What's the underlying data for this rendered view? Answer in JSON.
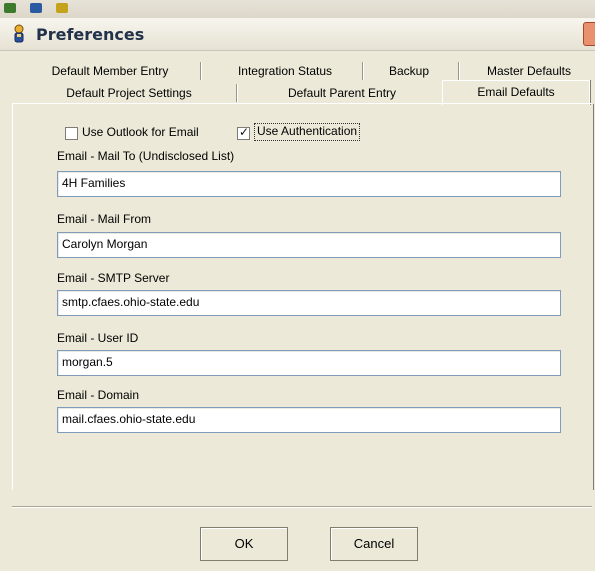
{
  "window": {
    "title": "Preferences"
  },
  "tabs": {
    "row1": [
      "Default Member Entry",
      "Integration Status",
      "Backup",
      "Master Defaults"
    ],
    "row2": [
      "Default Project Settings",
      "Default Parent Entry",
      "Email Defaults"
    ],
    "active": "Email Defaults"
  },
  "options": {
    "use_outlook_label": "Use Outlook for Email",
    "use_outlook_checked": false,
    "use_auth_label": "Use Authentication",
    "use_auth_checked": true,
    "check_mark": "✓"
  },
  "fields": {
    "mail_to_label": "Email - Mail To  (Undisclosed List)",
    "mail_to_value": "4H Families",
    "mail_from_label": "Email - Mail From",
    "mail_from_value": "Carolyn Morgan",
    "smtp_label": "Email - SMTP Server",
    "smtp_value": "smtp.cfaes.ohio-state.edu",
    "user_id_label": "Email - User ID",
    "user_id_value": "morgan.5",
    "domain_label": "Email - Domain",
    "domain_value": "mail.cfaes.ohio-state.edu"
  },
  "buttons": {
    "ok": "OK",
    "cancel": "Cancel"
  },
  "colors": {
    "dialog_bg": "#ece9d8",
    "field_border": "#7f9db9",
    "title_text": "#23324b"
  },
  "icons": {
    "title": "preferences-app-icon",
    "close": "close-icon"
  }
}
